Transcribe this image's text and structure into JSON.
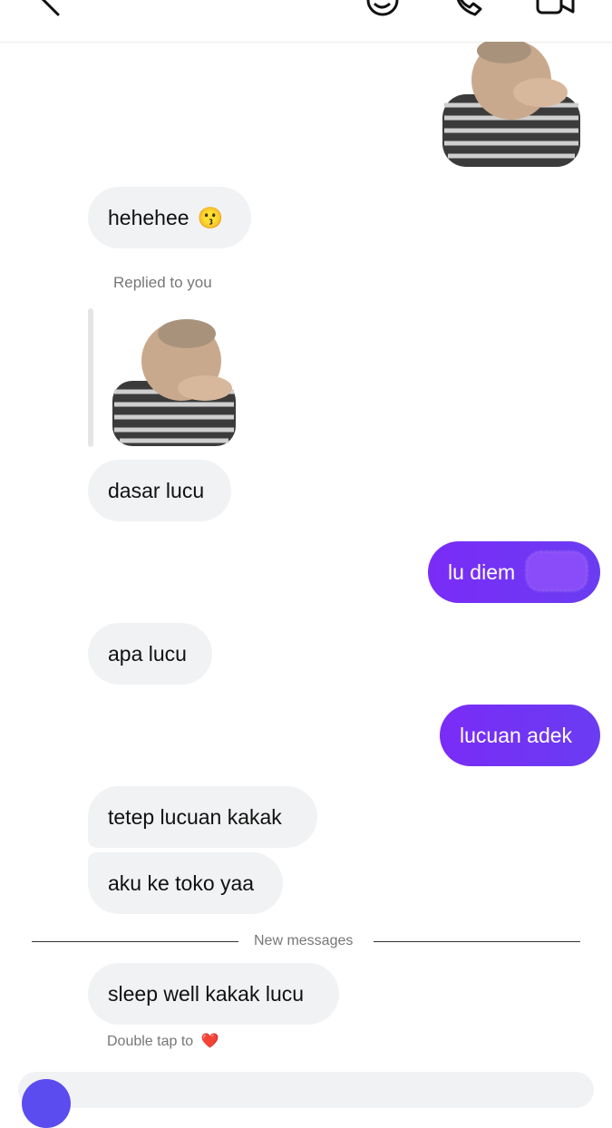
{
  "header": {
    "back_icon": "back-arrow-icon",
    "sticker_icon": "sticker-face-icon",
    "call_icon": "phone-icon",
    "video_icon": "video-camera-icon"
  },
  "messages": {
    "hehehee": "hehehee",
    "hehehee_emoji": "😗",
    "replied_to_you": "Replied to you",
    "dasar_lucu": "dasar lucu",
    "lu_diem": "lu diem",
    "apa_lucu": "apa lucu",
    "lucuan_adek": "lucuan adek",
    "tetep": "tetep lucuan kakak",
    "aku_ke_toko": "aku ke toko yaa",
    "new_messages": "New messages",
    "sleep_well": "sleep well kakak lucu",
    "double_tap": "Double tap to",
    "heart": "❤️"
  },
  "colors": {
    "outgoing": "#7a2cf6",
    "incoming": "#f1f2f4"
  }
}
